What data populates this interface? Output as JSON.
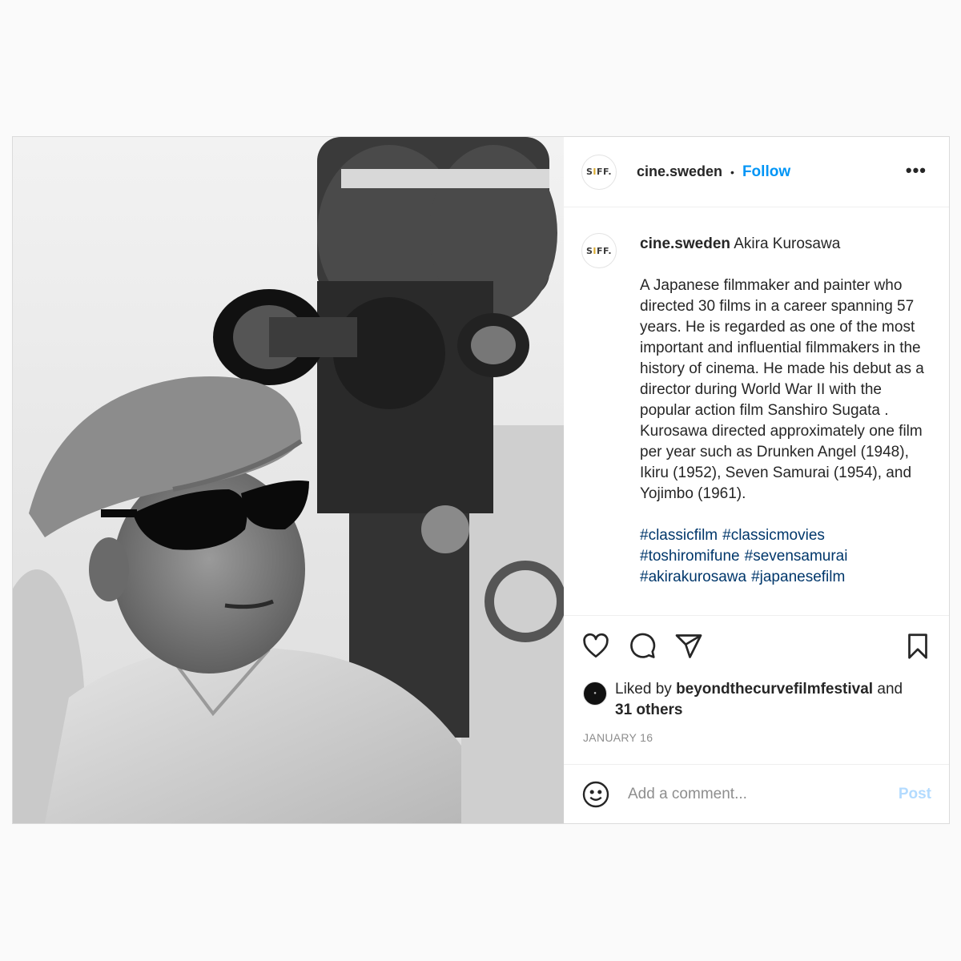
{
  "post": {
    "image_alt": "Akira Kurosawa with film camera",
    "account": {
      "username": "cine.sweden",
      "avatar_text": "SIFF",
      "separator": "•",
      "follow_label": "Follow",
      "more_icon": "more-options-icon"
    },
    "caption": {
      "username": "cine.sweden",
      "title": "Akira Kurosawa",
      "description": "A Japanese filmmaker and painter who directed 30 films in a career spanning 57 years. He is regarded as one of the most important and influential filmmakers in the history of cinema. He made his debut as a director during World War II with the popular action film Sanshiro Sugata . Kurosawa directed approximately one film per year such as Drunken Angel (1948), Ikiru (1952), Seven Samurai (1954), and Yojimbo (1961).",
      "hashtags": [
        "#classicfilm",
        "#classicmovies",
        "#toshiromifune",
        "#sevensamurai",
        "#akirakurosawa",
        "#japanesefilm"
      ]
    },
    "actions": {
      "like_icon": "heart-icon",
      "comment_icon": "comment-icon",
      "share_icon": "send-icon",
      "save_icon": "bookmark-icon"
    },
    "likes": {
      "prefix": "Liked by",
      "user": "beyondthecurvefilmfestival",
      "and": "and",
      "others": "31 others"
    },
    "date": "JANUARY 16",
    "comment": {
      "emoji_icon": "emoji-icon",
      "placeholder": "Add a comment...",
      "post_label": "Post"
    }
  }
}
